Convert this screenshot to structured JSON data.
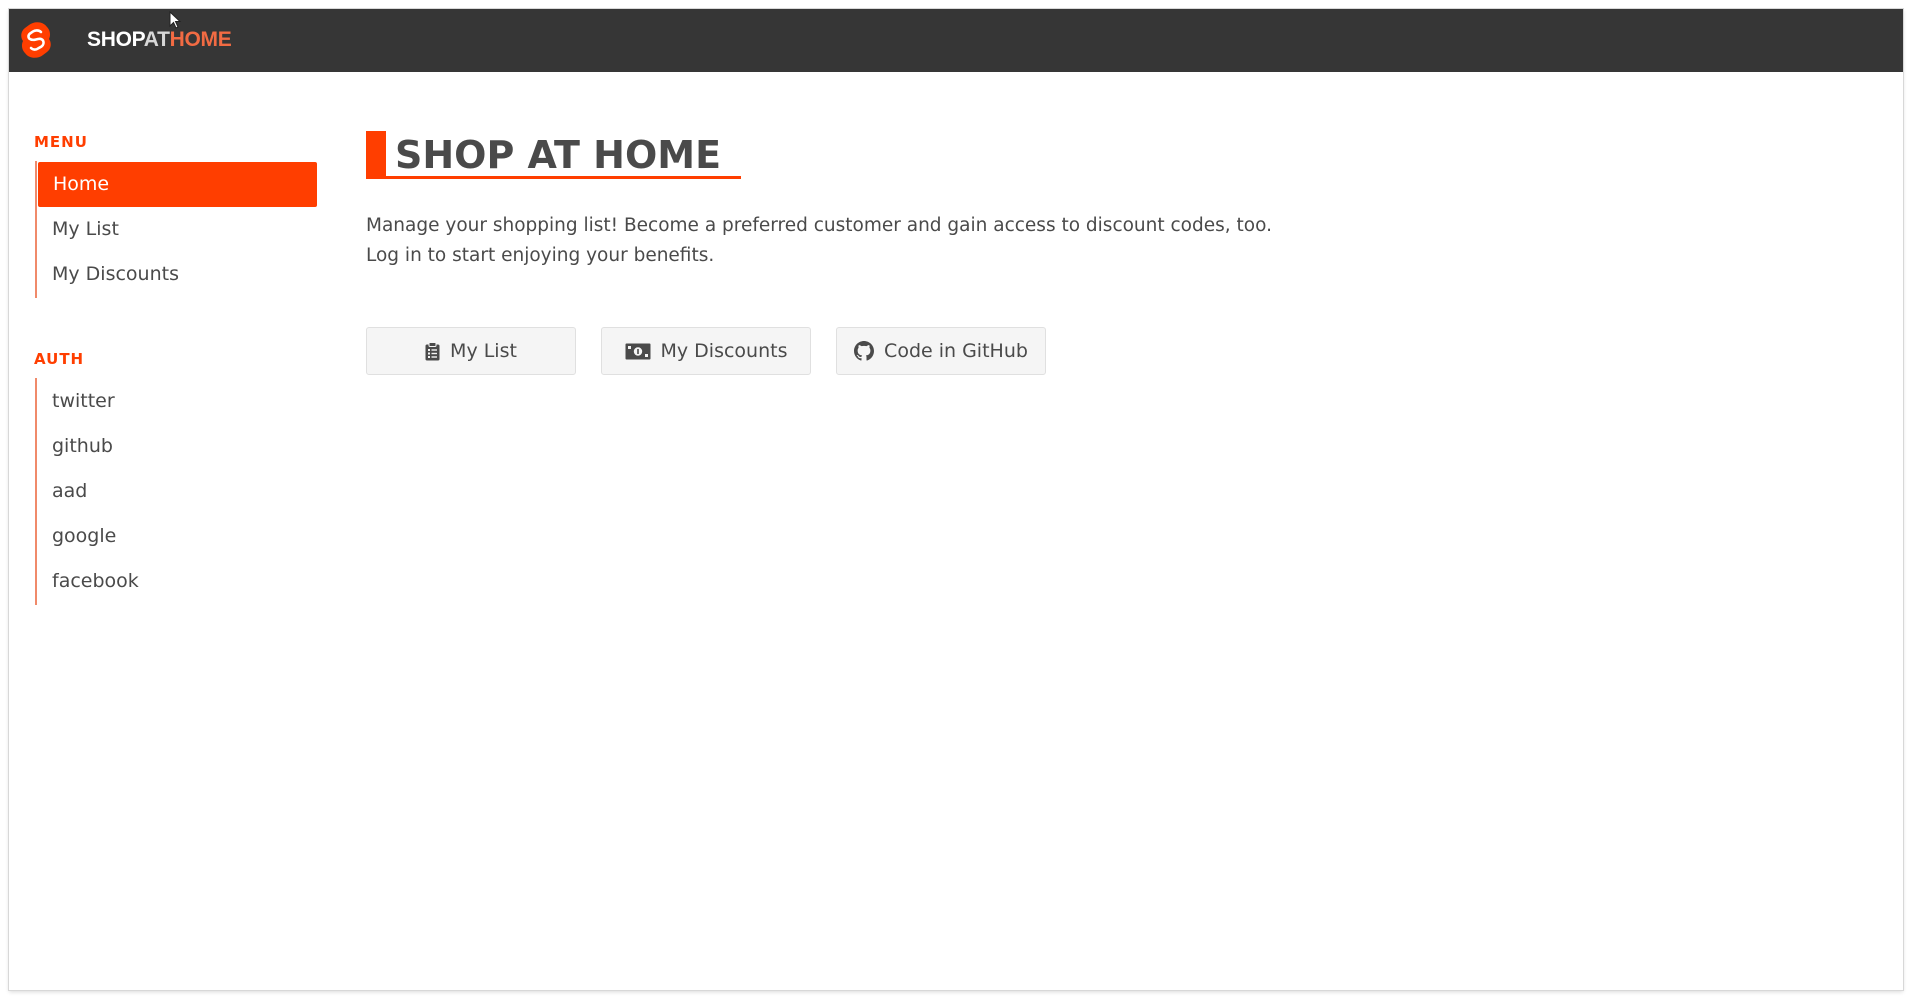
{
  "header": {
    "brand_part1": "SHOP",
    "brand_part2": "AT",
    "brand_part3": "HOME"
  },
  "sidebar": {
    "menu_label": "MENU",
    "menu_items": [
      {
        "label": "Home",
        "active": true
      },
      {
        "label": "My List",
        "active": false
      },
      {
        "label": "My Discounts",
        "active": false
      }
    ],
    "auth_label": "AUTH",
    "auth_items": [
      {
        "label": "twitter"
      },
      {
        "label": "github"
      },
      {
        "label": "aad"
      },
      {
        "label": "google"
      },
      {
        "label": "facebook"
      }
    ]
  },
  "main": {
    "title": "SHOP AT HOME",
    "description_line1": "Manage your shopping list! Become a preferred customer and gain access to discount codes, too.",
    "description_line2": "Log in to start enjoying your benefits.",
    "buttons": [
      {
        "label": "My List",
        "icon": "clipboard-icon"
      },
      {
        "label": "My Discounts",
        "icon": "money-bill-icon"
      },
      {
        "label": "Code in GitHub",
        "icon": "github-icon"
      }
    ]
  },
  "colors": {
    "accent": "#ff3e00",
    "topbar": "#363636",
    "text": "#4a4a4a"
  }
}
